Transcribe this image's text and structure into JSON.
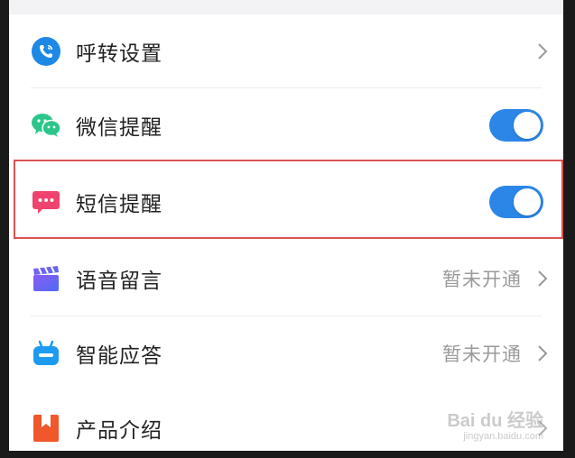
{
  "settings": {
    "items": [
      {
        "id": "call-forward",
        "label": "呼转设置",
        "status": "",
        "control": "chevron",
        "icon": "phone-icon",
        "icon_color": "#1e88e5"
      },
      {
        "id": "wechat-alert",
        "label": "微信提醒",
        "status": "",
        "control": "toggle",
        "enabled": true,
        "icon": "wechat-icon",
        "icon_color": "#2dc68a"
      },
      {
        "id": "sms-alert",
        "label": "短信提醒",
        "status": "",
        "control": "toggle",
        "enabled": true,
        "icon": "sms-icon",
        "icon_color": "#f0436d"
      },
      {
        "id": "voicemail",
        "label": "语音留言",
        "status": "暂未开通",
        "control": "chevron",
        "icon": "clapperboard-icon",
        "icon_color": "#6a5cf0"
      },
      {
        "id": "smart-answer",
        "label": "智能应答",
        "status": "暂未开通",
        "control": "chevron",
        "icon": "robot-icon",
        "icon_color": "#1e9bf0"
      },
      {
        "id": "product-intro",
        "label": "产品介绍",
        "status": "",
        "control": "chevron",
        "icon": "bookmark-icon",
        "icon_color": "#f0572b"
      }
    ]
  },
  "colors": {
    "toggle_on": "#2b86e8",
    "highlight_border": "#d9534f"
  },
  "watermark": {
    "main": "Bai du 经验",
    "sub": "jingyan.baidu.com"
  }
}
